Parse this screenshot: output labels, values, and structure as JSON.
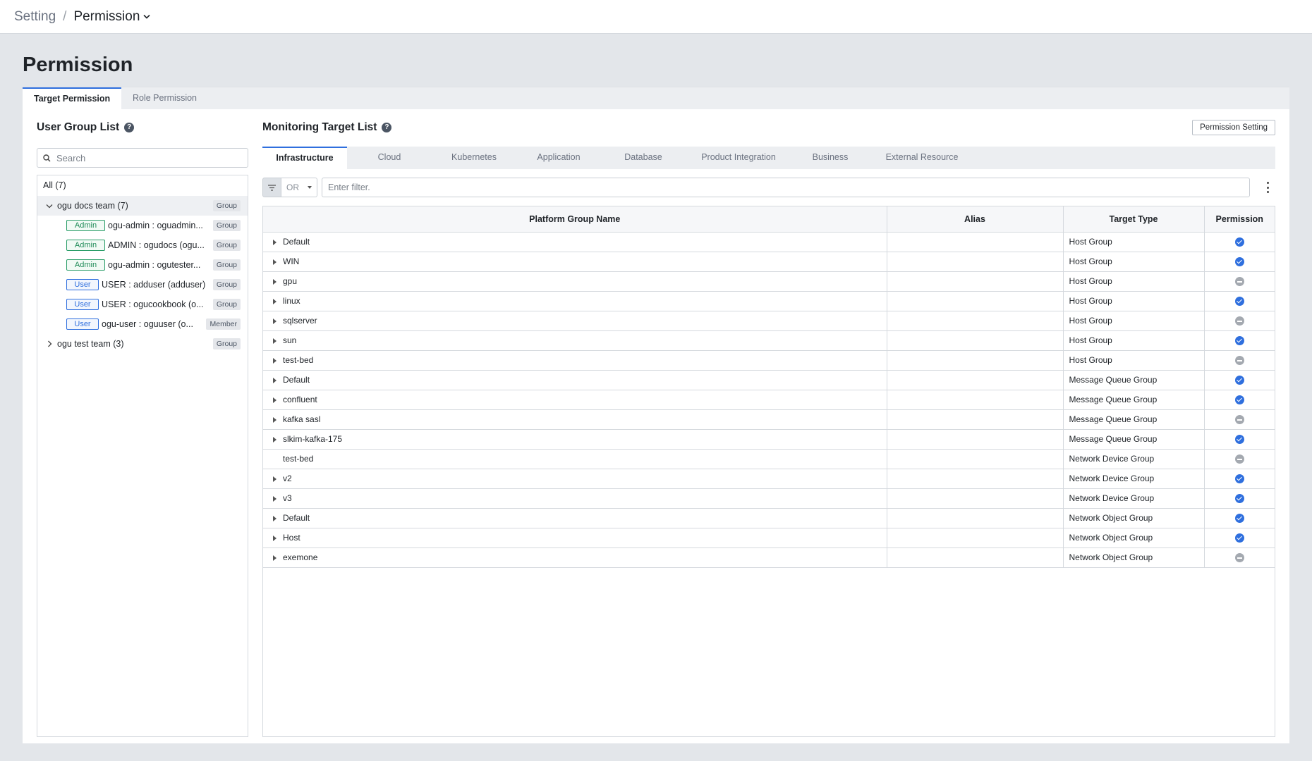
{
  "breadcrumb": {
    "root": "Setting",
    "separator": "/",
    "current": "Permission"
  },
  "page": {
    "title": "Permission"
  },
  "main_tabs": [
    {
      "label": "Target Permission",
      "active": true
    },
    {
      "label": "Role Permission",
      "active": false
    }
  ],
  "user_group": {
    "title": "User Group List",
    "search_placeholder": "Search",
    "all_label": "All (7)",
    "groups": [
      {
        "label": "ogu docs team (7)",
        "tag": "Group",
        "expanded": true,
        "children": [
          {
            "role": "Admin",
            "label": "ogu-admin : oguadmin...",
            "tag": "Group"
          },
          {
            "role": "Admin",
            "label": "ADMIN : ogudocs (ogu...",
            "tag": "Group"
          },
          {
            "role": "Admin",
            "label": "ogu-admin : ogutester...",
            "tag": "Group"
          },
          {
            "role": "User",
            "label": "USER : adduser (adduser)",
            "tag": "Group"
          },
          {
            "role": "User",
            "label": "USER : ogucookbook (o...",
            "tag": "Group"
          },
          {
            "role": "User",
            "label": "ogu-user : oguuser (o...",
            "tag": "Member"
          }
        ]
      },
      {
        "label": "ogu test team (3)",
        "tag": "Group",
        "expanded": false,
        "children": []
      }
    ]
  },
  "monitoring": {
    "title": "Monitoring Target List",
    "permission_setting_label": "Permission Setting",
    "tabs": [
      {
        "label": "Infrastructure",
        "active": true
      },
      {
        "label": "Cloud",
        "active": false
      },
      {
        "label": "Kubernetes",
        "active": false
      },
      {
        "label": "Application",
        "active": false
      },
      {
        "label": "Database",
        "active": false
      },
      {
        "label": "Product Integration",
        "active": false
      },
      {
        "label": "Business",
        "active": false
      },
      {
        "label": "External Resource",
        "active": false
      }
    ],
    "filter": {
      "operator": "OR",
      "placeholder": "Enter filter."
    },
    "columns": [
      "Platform Group Name",
      "Alias",
      "Target Type",
      "Permission"
    ],
    "rows": [
      {
        "name": "Default",
        "alias": "",
        "type": "Host Group",
        "permission": true,
        "expandable": true
      },
      {
        "name": "WIN",
        "alias": "",
        "type": "Host Group",
        "permission": true,
        "expandable": true
      },
      {
        "name": "gpu",
        "alias": "",
        "type": "Host Group",
        "permission": false,
        "expandable": true
      },
      {
        "name": "linux",
        "alias": "",
        "type": "Host Group",
        "permission": true,
        "expandable": true
      },
      {
        "name": "sqlserver",
        "alias": "",
        "type": "Host Group",
        "permission": false,
        "expandable": true
      },
      {
        "name": "sun",
        "alias": "",
        "type": "Host Group",
        "permission": true,
        "expandable": true
      },
      {
        "name": "test-bed",
        "alias": "",
        "type": "Host Group",
        "permission": false,
        "expandable": true
      },
      {
        "name": "Default",
        "alias": "",
        "type": "Message Queue Group",
        "permission": true,
        "expandable": true
      },
      {
        "name": "confluent",
        "alias": "",
        "type": "Message Queue Group",
        "permission": true,
        "expandable": true
      },
      {
        "name": "kafka sasl",
        "alias": "",
        "type": "Message Queue Group",
        "permission": false,
        "expandable": true
      },
      {
        "name": "slkim-kafka-175",
        "alias": "",
        "type": "Message Queue Group",
        "permission": true,
        "expandable": true
      },
      {
        "name": "test-bed",
        "alias": "",
        "type": "Network Device Group",
        "permission": false,
        "expandable": false
      },
      {
        "name": "v2",
        "alias": "",
        "type": "Network Device Group",
        "permission": true,
        "expandable": true
      },
      {
        "name": "v3",
        "alias": "",
        "type": "Network Device Group",
        "permission": true,
        "expandable": true
      },
      {
        "name": "Default",
        "alias": "",
        "type": "Network Object Group",
        "permission": true,
        "expandable": true
      },
      {
        "name": "Host",
        "alias": "",
        "type": "Network Object Group",
        "permission": true,
        "expandable": true
      },
      {
        "name": "exemone",
        "alias": "",
        "type": "Network Object Group",
        "permission": false,
        "expandable": true
      }
    ]
  },
  "colors": {
    "accent": "#2f6fde",
    "admin": "#2a9d68",
    "background": "#e3e6ea"
  }
}
